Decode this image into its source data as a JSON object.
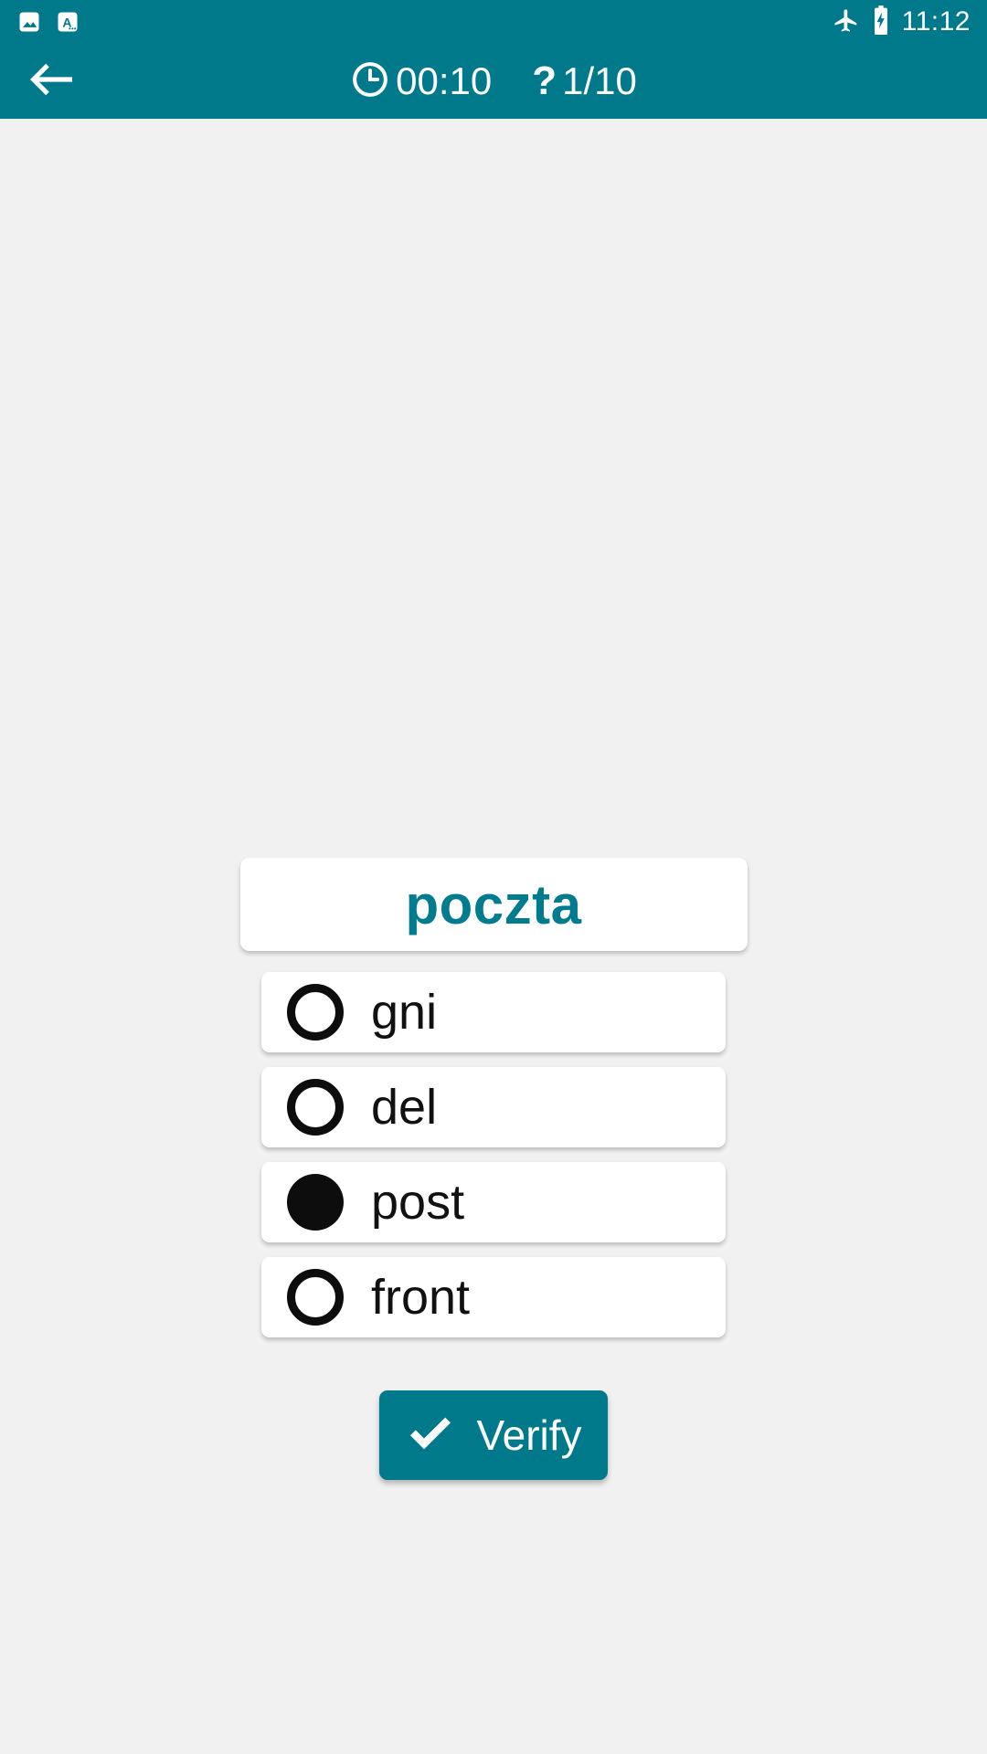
{
  "status_bar": {
    "notifications": [
      {
        "icon": "image-notification-icon"
      },
      {
        "icon": "text-translate-notification-icon"
      }
    ],
    "airplane_icon": "airplane-mode-icon",
    "battery_icon": "battery-charging-icon",
    "time": "11:12"
  },
  "app_bar": {
    "back_icon": "back-arrow-icon",
    "timer_icon": "clock-icon",
    "timer": "00:10",
    "question_icon": "question-mark-icon",
    "question_counter": "1/10"
  },
  "quiz": {
    "word": "poczta",
    "options": [
      {
        "label": "gni",
        "selected": false
      },
      {
        "label": "del",
        "selected": false
      },
      {
        "label": "post",
        "selected": true
      },
      {
        "label": "front",
        "selected": false
      }
    ],
    "verify_label": "Verify",
    "verify_icon": "check-icon"
  },
  "colors": {
    "accent": "#00798b",
    "word": "#017b8e",
    "background": "#f1f1f1",
    "card": "#ffffff",
    "radio": "#0d0d0d"
  }
}
